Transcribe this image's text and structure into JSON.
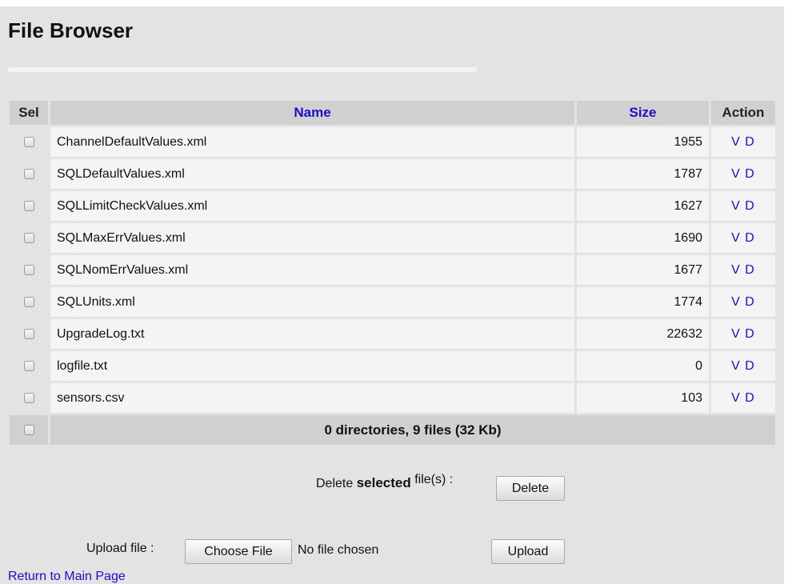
{
  "page": {
    "title": "File Browser"
  },
  "table": {
    "headers": {
      "sel": "Sel",
      "name": "Name",
      "size": "Size",
      "action": "Action"
    },
    "rows": [
      {
        "name": "ChannelDefaultValues.xml",
        "size": "1955",
        "actions": "V D"
      },
      {
        "name": "SQLDefaultValues.xml",
        "size": "1787",
        "actions": "V D"
      },
      {
        "name": "SQLLimitCheckValues.xml",
        "size": "1627",
        "actions": "V D"
      },
      {
        "name": "SQLMaxErrValues.xml",
        "size": "1690",
        "actions": "V D"
      },
      {
        "name": "SQLNomErrValues.xml",
        "size": "1677",
        "actions": "V D"
      },
      {
        "name": "SQLUnits.xml",
        "size": "1774",
        "actions": "V D"
      },
      {
        "name": "UpgradeLog.txt",
        "size": "22632",
        "actions": "V D"
      },
      {
        "name": "logfile.txt",
        "size": "0",
        "actions": "V D"
      },
      {
        "name": "sensors.csv",
        "size": "103",
        "actions": "V D"
      }
    ],
    "summary": "0 directories, 9 files (32 Kb)"
  },
  "delete_section": {
    "prefix": "Delete",
    "selected": "selected",
    "suffix": "file(s) :",
    "button": "Delete"
  },
  "upload_section": {
    "label": "Upload file :",
    "choose_button": "Choose File",
    "status": "No file chosen",
    "button": "Upload"
  },
  "footer": {
    "return_link": "Return to Main Page"
  },
  "colors": {
    "panel": "#e3e3e3",
    "link": "#1a0dcc",
    "header_bg": "#d0d0d0",
    "cell_bg": "#f4f4f4"
  }
}
